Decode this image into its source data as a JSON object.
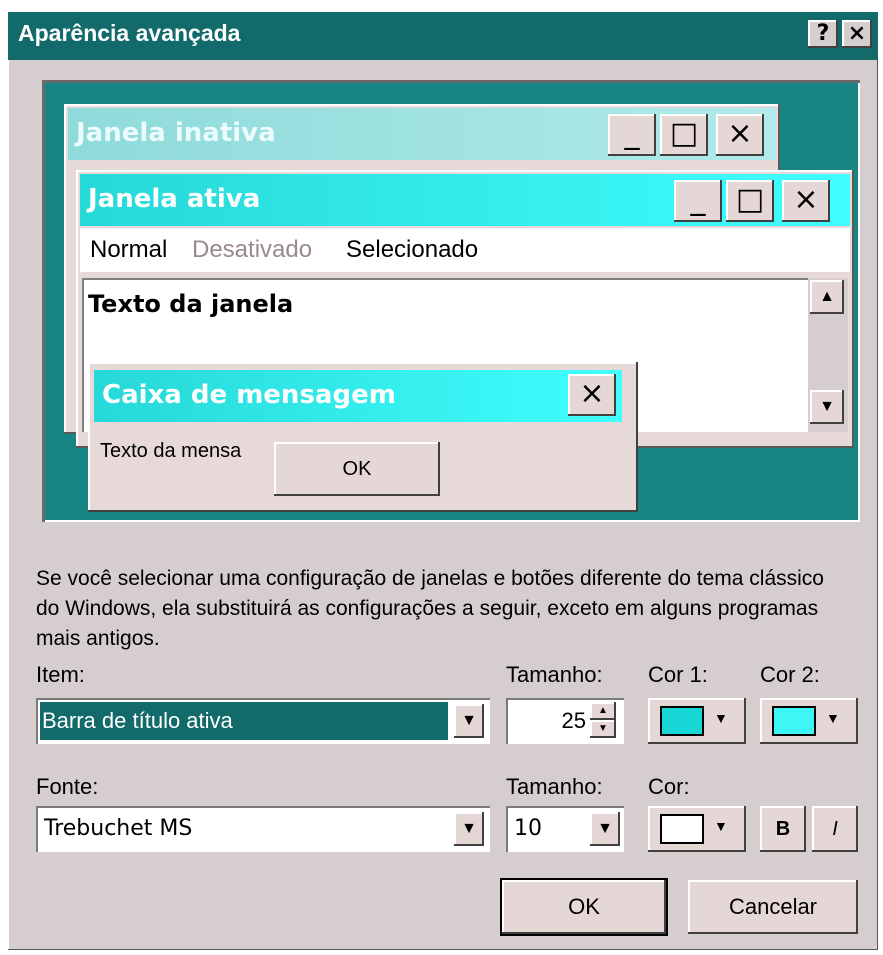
{
  "window": {
    "title": "Aparência avançada",
    "help_label": "?",
    "close_label": "×"
  },
  "preview": {
    "inactive_title": "Janela inativa",
    "active_title": "Janela ativa",
    "control_minimize": "_",
    "control_maximize": "□",
    "control_close": "×",
    "menu_normal": "Normal",
    "menu_disabled": "Desativado",
    "menu_selected": "Selecionado",
    "window_text": "Texto da janela",
    "scroll_up": "▲",
    "scroll_down": "▼",
    "msgbox_title": "Caixa de mensagem",
    "msgbox_close": "×",
    "msgbox_text": "Texto da mensa",
    "msgbox_ok": "OK"
  },
  "info_text": "Se você selecionar uma configuração de janelas e botões diferente do tema clássico do Windows, ela substituirá as configurações a seguir, exceto em alguns programas mais antigos.",
  "item_row": {
    "item_label": "Item:",
    "item_value": "Barra de título ativa",
    "size_label": "Tamanho:",
    "size_value": "25",
    "color1_label": "Cor 1:",
    "color2_label": "Cor 2:",
    "color1": "#17d6d6",
    "color2": "#3ff6f6"
  },
  "font_row": {
    "font_label": "Fonte:",
    "font_value": "Trebuchet MS",
    "size_label": "Tamanho:",
    "size_value": "10",
    "color_label": "Cor:",
    "color": "#ffffff",
    "bold_label": "B",
    "italic_label": "I"
  },
  "footer": {
    "ok_label": "OK",
    "cancel_label": "Cancelar"
  },
  "icons": {
    "dropdown_arrow": "▼",
    "spin_up": "▲",
    "spin_down": "▼"
  }
}
